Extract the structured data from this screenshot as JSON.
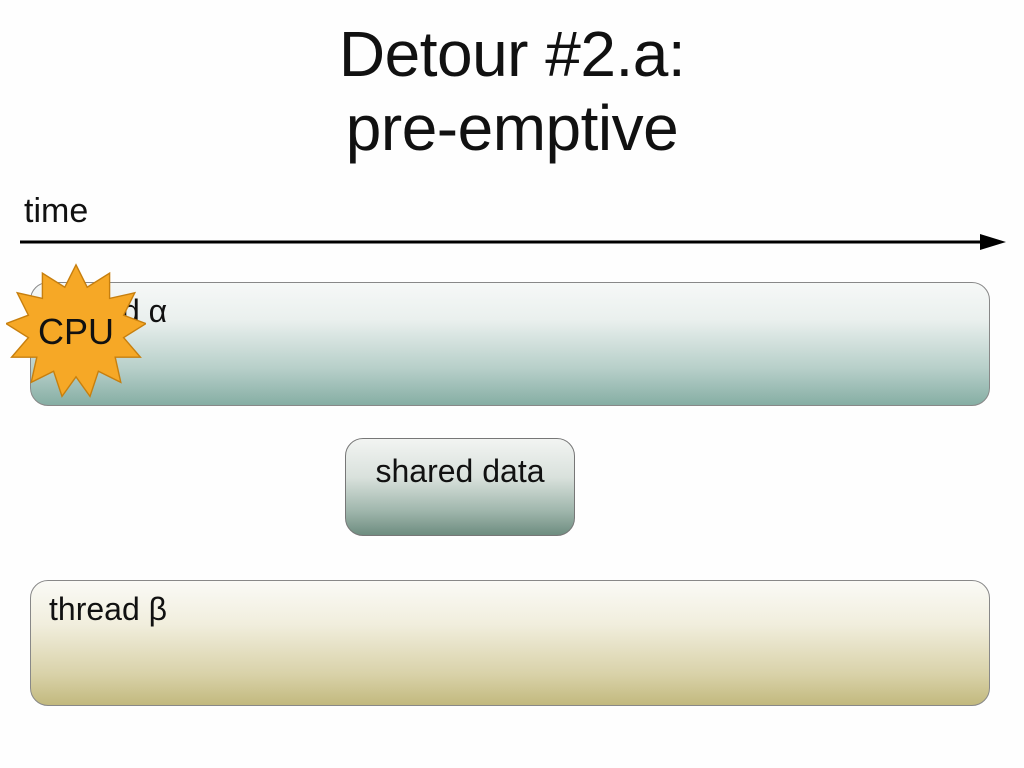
{
  "title_line1": "Detour #2.a:",
  "title_line2": "pre-emptive",
  "time_label": "time",
  "thread_alpha_label": "thread α",
  "thread_beta_label": "thread β",
  "shared_label": "shared data",
  "cpu_label": "CPU",
  "colors": {
    "alpha_gradient_end": "#86aea4",
    "beta_gradient_end": "#c2b97e",
    "shared_gradient_end": "#6e8d80",
    "cpu_fill": "#f6a826",
    "cpu_stroke": "#c77f0e"
  }
}
